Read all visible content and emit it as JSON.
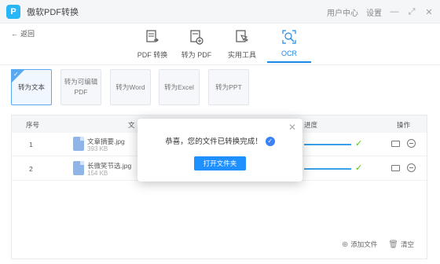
{
  "app": {
    "title": "傲软PDF转换",
    "logo_letter": "P",
    "user_center": "用户中心",
    "settings": "设置",
    "min_symbol": "—",
    "max_symbol": "⤢",
    "close_symbol": "✕"
  },
  "nav": {
    "back_label": "返回",
    "tabs": [
      {
        "label": "PDF 转换",
        "icon": "pdf-convert-icon"
      },
      {
        "label": "转为 PDF",
        "icon": "to-pdf-icon"
      },
      {
        "label": "实用工具",
        "icon": "tools-icon"
      },
      {
        "label": "OCR",
        "icon": "ocr-icon"
      }
    ]
  },
  "options": [
    {
      "label": "转为文本",
      "active": true
    },
    {
      "label": "转为可编辑PDF",
      "active": false
    },
    {
      "label": "转为Word",
      "active": false
    },
    {
      "label": "转为Excel",
      "active": false
    },
    {
      "label": "转为PPT",
      "active": false
    }
  ],
  "table": {
    "headers": {
      "index": "序号",
      "file": "文",
      "progress": "进度",
      "actions": "操作"
    },
    "rows": [
      {
        "index": "1",
        "name": "文章摘要.jpg",
        "size": "393 KB",
        "progress": 1.0
      },
      {
        "index": "2",
        "name": "长微笑节选.jpg",
        "size": "154 KB",
        "progress": 1.0
      }
    ],
    "add_file": "添加文件",
    "clear": "清空"
  },
  "modal": {
    "message": "恭喜，您的文件已转换完成！",
    "button": "打开文件夹",
    "close_symbol": "✕"
  },
  "colors": {
    "accent": "#1e90ff",
    "success": "#52c41a",
    "logo": "#29b6f6"
  }
}
